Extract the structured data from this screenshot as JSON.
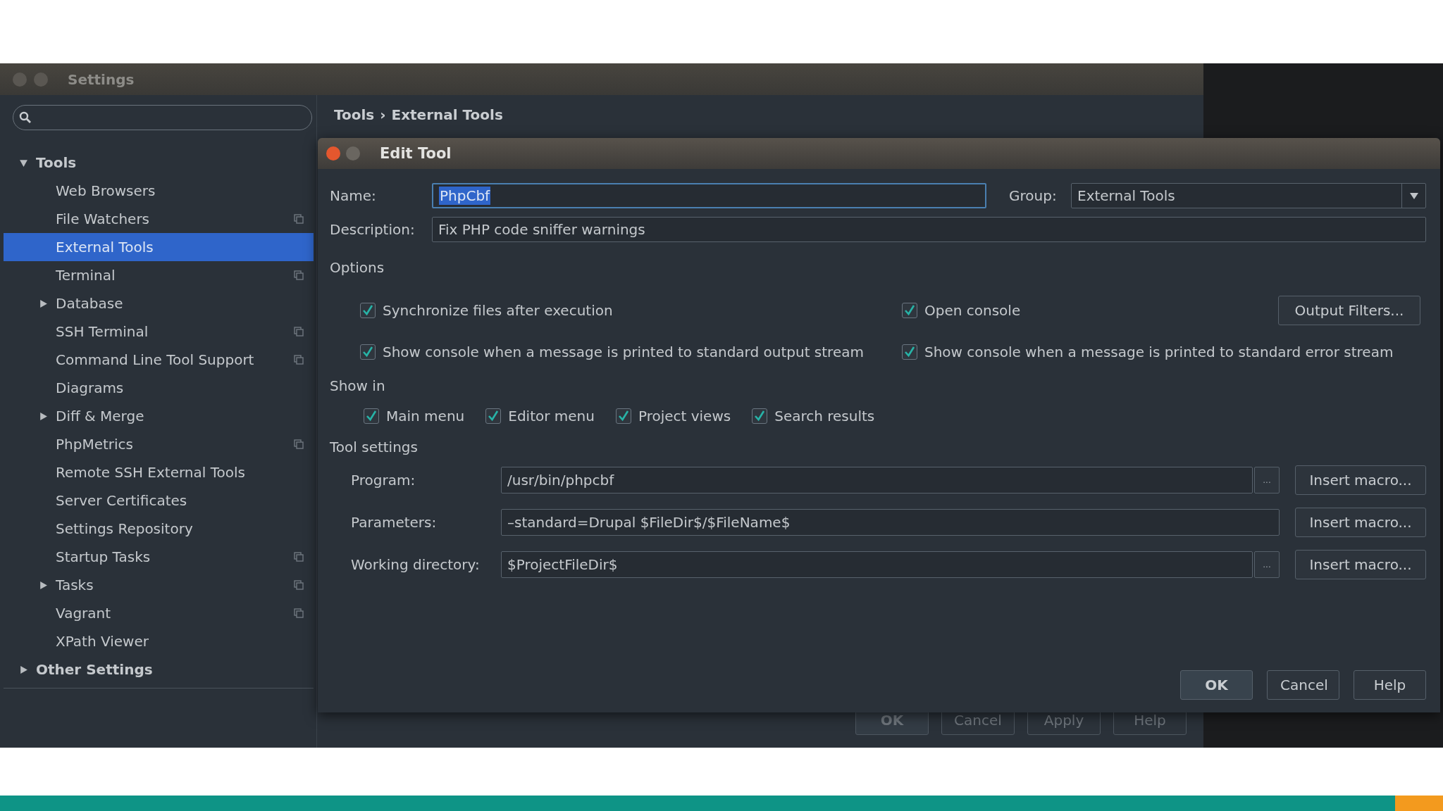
{
  "settings": {
    "title": "Settings",
    "breadcrumb": [
      "Tools",
      "External Tools"
    ],
    "breadcrumb_separator": "›",
    "sidebar": [
      {
        "label": "Tools",
        "expanded": true,
        "selected": false,
        "shared": false,
        "children": [
          {
            "label": "Web Browsers",
            "selected": false,
            "shared": false
          },
          {
            "label": "File Watchers",
            "selected": false,
            "shared": true
          },
          {
            "label": "External Tools",
            "selected": true,
            "shared": false
          },
          {
            "label": "Terminal",
            "selected": false,
            "shared": true
          },
          {
            "label": "Database",
            "expanded": false,
            "selected": false,
            "shared": false
          },
          {
            "label": "SSH Terminal",
            "selected": false,
            "shared": true
          },
          {
            "label": "Command Line Tool Support",
            "selected": false,
            "shared": true
          },
          {
            "label": "Diagrams",
            "selected": false,
            "shared": false
          },
          {
            "label": "Diff & Merge",
            "expanded": false,
            "selected": false,
            "shared": false
          },
          {
            "label": "PhpMetrics",
            "selected": false,
            "shared": true
          },
          {
            "label": "Remote SSH External Tools",
            "selected": false,
            "shared": false
          },
          {
            "label": "Server Certificates",
            "selected": false,
            "shared": false
          },
          {
            "label": "Settings Repository",
            "selected": false,
            "shared": false
          },
          {
            "label": "Startup Tasks",
            "selected": false,
            "shared": true
          },
          {
            "label": "Tasks",
            "expanded": false,
            "selected": false,
            "shared": true
          },
          {
            "label": "Vagrant",
            "selected": false,
            "shared": true
          },
          {
            "label": "XPath Viewer",
            "selected": false,
            "shared": false
          }
        ]
      },
      {
        "label": "Other Settings",
        "expanded": false,
        "selected": false,
        "shared": false
      }
    ],
    "buttons": [
      {
        "label": "OK",
        "default": true
      },
      {
        "label": "Cancel",
        "default": false
      },
      {
        "label": "Apply",
        "default": false
      },
      {
        "label": "Help",
        "default": false
      }
    ]
  },
  "dialog": {
    "title": "Edit Tool",
    "name": {
      "label": "Name:",
      "value": "PhpCbf",
      "text_selected": true
    },
    "group": {
      "label": "Group:",
      "value": "External Tools"
    },
    "description": {
      "label": "Description:",
      "value": "Fix PHP code sniffer warnings"
    },
    "options": {
      "heading": "Options",
      "filters_button": "Output Filters...",
      "checks": [
        {
          "label": "Synchronize files after execution",
          "checked": true
        },
        {
          "label": "Open console",
          "checked": true
        },
        {
          "label": "Show console when a message is printed to standard output stream",
          "checked": true
        },
        {
          "label": "Show console when a message is printed to standard error stream",
          "checked": true
        }
      ]
    },
    "show_in": {
      "heading": "Show in",
      "checks": [
        {
          "label": "Main menu",
          "checked": true
        },
        {
          "label": "Editor menu",
          "checked": true
        },
        {
          "label": "Project views",
          "checked": true
        },
        {
          "label": "Search results",
          "checked": true
        }
      ]
    },
    "tool_settings": {
      "heading": "Tool settings",
      "rows": [
        {
          "label": "Program:",
          "value": "/usr/bin/phpcbf",
          "browse": "...",
          "macro_button": "Insert macro..."
        },
        {
          "label": "Parameters:",
          "value": "–standard=Drupal $FileDir$/$FileName$",
          "macro_button": "Insert macro..."
        },
        {
          "label": "Working directory:",
          "value": "$ProjectFileDir$",
          "browse": "...",
          "macro_button": "Insert macro..."
        }
      ]
    },
    "buttons": [
      {
        "label": "OK",
        "default": true
      },
      {
        "label": "Cancel",
        "default": false
      },
      {
        "label": "Help",
        "default": false
      }
    ]
  }
}
